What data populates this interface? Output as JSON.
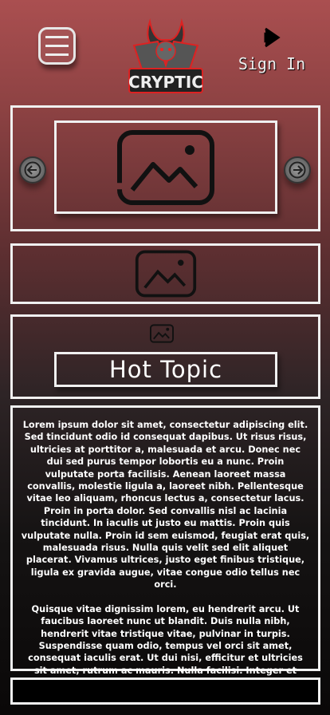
{
  "header": {
    "menu_icon": "hamburger-icon",
    "logo_text": "CRYPTIC",
    "signin_label": "Sign In",
    "signin_icon": "play-arrow-icon"
  },
  "carousel": {
    "prev_icon": "arrow-left-icon",
    "next_icon": "arrow-right-icon",
    "image_icon": "image-placeholder-icon"
  },
  "featured": {
    "title": "Hot Topic"
  },
  "article": {
    "paragraphs": [
      "Lorem ipsum dolor sit amet, consectetur adipiscing elit. Sed tincidunt odio id consequat dapibus. Ut risus risus, ultricies at porttitor a, malesuada et arcu. Donec nec dui sed purus tempor lobortis eu a nunc. Proin vulputate porta facilisis. Aenean laoreet massa convallis, molestie ligula a, laoreet nibh. Pellentesque vitae leo aliquam, rhoncus lectus a, consectetur lacus. Proin in porta dolor. Sed convallis nisl ac lacinia tincidunt. In iaculis ut justo eu mattis. Proin quis vulputate nulla. Proin id sem euismod, feugiat erat quis, malesuada risus. Nulla quis velit sed elit aliquet placerat. Vivamus ultrices, justo eget finibus tristique, ligula ex gravida augue, vitae congue odio tellus nec orci.",
      "Quisque vitae dignissim lorem, eu hendrerit arcu. Ut faucibus laoreet nunc ut blandit. Duis nulla nibh, hendrerit vitae tristique vitae, pulvinar in turpis. Suspendisse quam odio, tempus vel orci sit amet, consequat iaculis erat. Ut dui nisi, efficitur et ultricies sit amet, rutrum ac mauris. Nulla facilisi. Integer et turpis non nunc accumsan malesuada at in nunc."
    ]
  }
}
